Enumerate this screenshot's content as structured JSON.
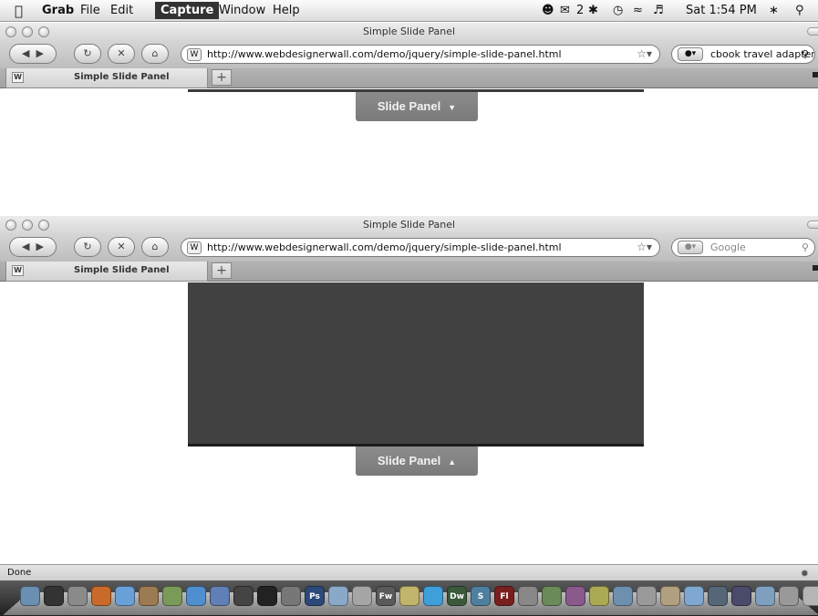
{
  "menubar": {
    "apple_icon": "apple-logo-icon",
    "app_name": "Grab",
    "items": [
      "File",
      "Edit",
      "Capture",
      "Window",
      "Help"
    ],
    "active_item": "Capture",
    "tray": {
      "notification_count": "2",
      "clock": "Sat 1:54 PM"
    }
  },
  "window_top": {
    "title": "Simple Slide Panel",
    "url": "http://www.webdesignerwall.com/demo/jquery/simple-slide-panel.html",
    "search_value": "cbook travel adapter",
    "tab_label": "Simple Slide Panel",
    "new_tab_label": "+",
    "favicon_letter": "W",
    "button_label": "Slide Panel",
    "button_arrow": "▼"
  },
  "window_bottom": {
    "title": "Simple Slide Panel",
    "url": "http://www.webdesignerwall.com/demo/jquery/simple-slide-panel.html",
    "search_placeholder": "Google",
    "tab_label": "Simple Slide Panel",
    "new_tab_label": "+",
    "favicon_letter": "W",
    "button_label": "Slide Panel",
    "button_arrow": "▲"
  },
  "statusbar": {
    "text": "Done"
  },
  "dock": {
    "items": [
      {
        "name": "finder",
        "label": "",
        "color": "#6b8fb0"
      },
      {
        "name": "dashboard",
        "label": "",
        "color": "#333333"
      },
      {
        "name": "system-prefs",
        "label": "",
        "color": "#8a8a8a"
      },
      {
        "name": "firefox",
        "label": "",
        "color": "#c96a2a"
      },
      {
        "name": "ichat",
        "label": "",
        "color": "#6aa0d8"
      },
      {
        "name": "address-book",
        "label": "",
        "color": "#9c7b52"
      },
      {
        "name": "preview",
        "label": "",
        "color": "#7a9a5a"
      },
      {
        "name": "safari",
        "label": "",
        "color": "#4f8fd0"
      },
      {
        "name": "itunes",
        "label": "",
        "color": "#5f7fb5"
      },
      {
        "name": "photo-booth",
        "label": "",
        "color": "#444444"
      },
      {
        "name": "terminal",
        "label": "",
        "color": "#222222"
      },
      {
        "name": "script-editor",
        "label": "",
        "color": "#777777"
      },
      {
        "name": "photoshop",
        "label": "Ps",
        "color": "#2b4a7a"
      },
      {
        "name": "mail",
        "label": "",
        "color": "#8aa9c9"
      },
      {
        "name": "transmit",
        "label": "",
        "color": "#a5a5a5"
      },
      {
        "name": "fireworks",
        "label": "Fw",
        "color": "#5a5a5a"
      },
      {
        "name": "adium",
        "label": "",
        "color": "#c2b46a"
      },
      {
        "name": "skype",
        "label": "",
        "color": "#3f9fd8"
      },
      {
        "name": "dreamweaver",
        "label": "Dw",
        "color": "#3a5a3a"
      },
      {
        "name": "snippets",
        "label": "S",
        "color": "#4f7f9f"
      },
      {
        "name": "flash",
        "label": "Fl",
        "color": "#7a1f1f"
      },
      {
        "name": "istat",
        "label": "",
        "color": "#888888"
      },
      {
        "name": "coda",
        "label": "",
        "color": "#6a8a5a"
      },
      {
        "name": "textmate",
        "label": "",
        "color": "#8a5a8a"
      },
      {
        "name": "cyberduck",
        "label": "",
        "color": "#aaaa55"
      },
      {
        "name": "dashcode",
        "label": "",
        "color": "#6f8faf"
      },
      {
        "name": "utility",
        "label": "",
        "color": "#9a9a9a"
      },
      {
        "name": "mail-stamp",
        "label": "",
        "color": "#b0a080"
      },
      {
        "name": "chat",
        "label": "",
        "color": "#7fa7cf"
      },
      {
        "name": "time-machine",
        "label": "",
        "color": "#556677"
      },
      {
        "name": "itunes-store",
        "label": "",
        "color": "#4a4a6a"
      },
      {
        "name": "folder",
        "label": "",
        "color": "#7f9fbf"
      },
      {
        "name": "documents",
        "label": "",
        "color": "#999999"
      },
      {
        "name": "trash",
        "label": "",
        "color": "#b5b5b5"
      }
    ]
  },
  "colors": {
    "panel_dark": "#414141",
    "panel_border": "#1c1c1c",
    "slide_button": "#838383",
    "menu_active": "#333333"
  }
}
